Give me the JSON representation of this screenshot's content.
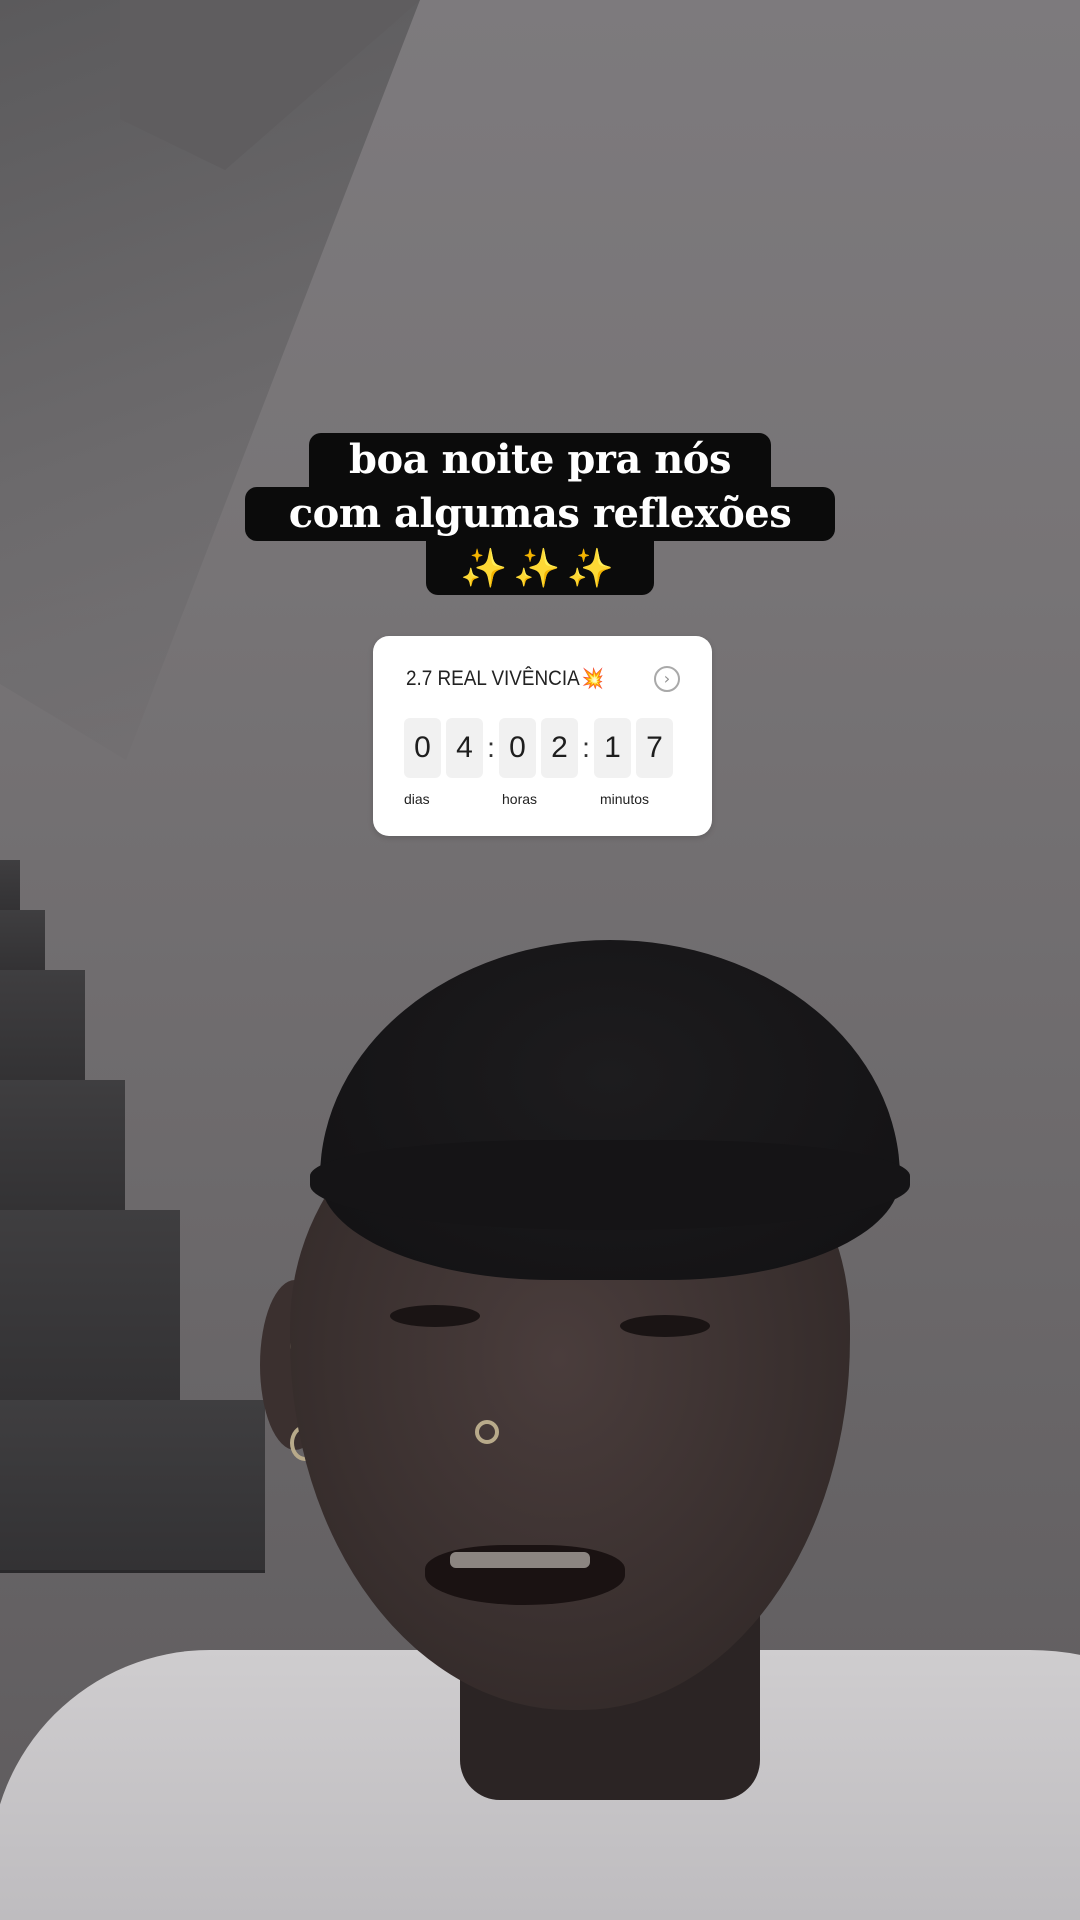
{
  "caption": {
    "line1": "boa noite pra nós",
    "line2": "com algumas reflexões",
    "line3": "✨✨✨"
  },
  "countdown": {
    "title": "2.7 REAL VIVÊNCIA",
    "title_emoji": "💥",
    "action_icon": "chevron-right-circle-icon",
    "days": [
      "0",
      "4"
    ],
    "hours": [
      "0",
      "2"
    ],
    "minutes": [
      "1",
      "7"
    ],
    "separator": ":",
    "labels": {
      "days": "dias",
      "hours": "horas",
      "minutes": "minutos"
    }
  },
  "colors": {
    "caption_bg": "#0b0b0b",
    "caption_text": "#ffffff",
    "sparkles": "#f3c63c",
    "sticker_bg": "#ffffff",
    "digit_bg": "#f1f1f1"
  }
}
